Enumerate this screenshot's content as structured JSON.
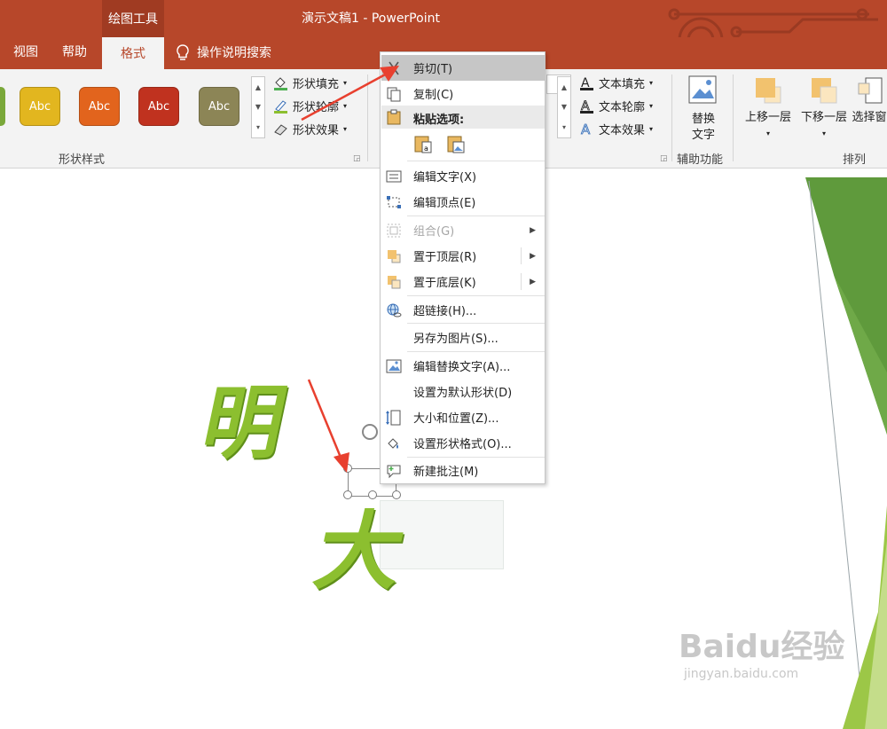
{
  "titlebar": {
    "tool_context": "绘图工具",
    "doc_title": "演示文稿1  -  PowerPoint"
  },
  "tabs": {
    "view": "视图",
    "help": "帮助",
    "format": "格式",
    "tell_me": "操作说明搜索"
  },
  "ribbon": {
    "shape_styles": {
      "swatches": [
        {
          "label": "Abc",
          "color": "#e2b61f"
        },
        {
          "label": "Abc",
          "color": "#e2641d"
        },
        {
          "label": "Abc",
          "color": "#c0321f"
        },
        {
          "label": "Abc",
          "color": "#8c8556"
        }
      ],
      "fill": "形状填充",
      "outline": "形状轮廓",
      "effects": "形状效果",
      "group_label": "形状样式"
    },
    "text": {
      "fill": "文本填充",
      "outline": "文本轮廓",
      "effects": "文本效果"
    },
    "alt_text": {
      "line1": "替换",
      "line2": "文字",
      "group_label": "辅助功能"
    },
    "arrange": {
      "bring_forward": "上移一层",
      "send_backward": "下移一层",
      "selection_pane": "选择窗",
      "group_label": "排列"
    }
  },
  "slide": {
    "char1": "明",
    "char2": "大"
  },
  "context_menu": {
    "cut": "剪切(T)",
    "copy": "复制(C)",
    "paste_options": "粘贴选项:",
    "edit_text": "编辑文字(X)",
    "edit_points": "编辑顶点(E)",
    "group": "组合(G)",
    "bring_to_front": "置于顶层(R)",
    "send_to_back": "置于底层(K)",
    "hyperlink": "超链接(H)...",
    "save_as_picture": "另存为图片(S)...",
    "edit_alt_text": "编辑替换文字(A)...",
    "set_default_shape": "设置为默认形状(D)",
    "size_position": "大小和位置(Z)...",
    "format_shape": "设置形状格式(O)...",
    "new_comment": "新建批注(M)"
  },
  "watermark": {
    "brand": "Baidu经验",
    "url": "jingyan.baidu.com"
  },
  "colors": {
    "accent": "#b7472a",
    "arrow": "#e8402f",
    "char_green": "#8cbf2f"
  }
}
